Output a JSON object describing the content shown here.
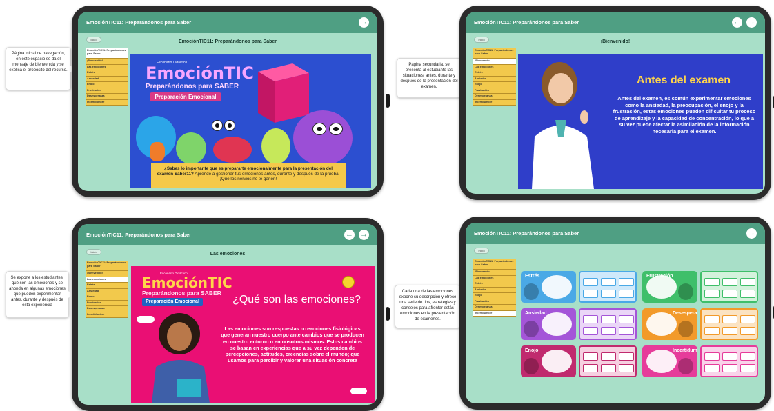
{
  "app": {
    "title": "EmociónTIC11: Preparándonos para Saber",
    "inicio_label": "Inicio",
    "menu": [
      "EmociónTIC11: Preparándonos para Saber",
      "¡Bienvenido!",
      "Las emociones",
      "Estrés",
      "Ansiedad",
      "Enojo",
      "Frustración",
      "Desesperanza",
      "Incertidumbre"
    ]
  },
  "panels": [
    {
      "page_title": "EmociónTIC11: Preparándonos para Saber",
      "callout": "Página inicial de navegación, en este espacio se da el mensaje de bienvenida y se explica el propósito del recurso.",
      "active_item": 0,
      "hero": {
        "kicker": "Escenario Didáctico",
        "brand": "EmociónTIC",
        "subtitle": "Preparándonos para SABER",
        "pill": "Preparación Emocional",
        "question": "¿Sabes lo importante que es prepararte emocionalmente para la presentación del examen Saber11?",
        "body": "Aprende a gestionar tus emociones antes, durante y después de la prueba. ¡Que los nervios no te ganen!"
      }
    },
    {
      "page_title": "¡Bienvenido!",
      "callout": "Página secundaria, se presenta al estudiante las situaciones, antes, durante y después de la presentación del examen.",
      "active_item": 1,
      "hero": {
        "title": "Antes del examen",
        "body": "Antes del examen, es común experimentar emociones como la ansiedad, la preocupación, el enojo y la frustración, estas emociones pueden dificultar tu proceso de aprendizaje y la capacidad de concentración, lo que a su vez puede afectar la asimilación de la información necesaria para el examen."
      }
    },
    {
      "page_title": "Las emociones",
      "callout": "Se expone a los estudiantes, qué son las emociones y se ahonda en algunas emociones que pueden experimentar antes, durante y después de esta experiencia",
      "active_item": 2,
      "hero": {
        "kicker": "Escenario Didáctico",
        "brand": "EmociónTIC",
        "subtitle": "Preparándonos para SABER",
        "pill": "Preparación Emocional",
        "question": "¿Qué son las emociones?",
        "body": "Las emociones son respuestas o reacciones fisiológicas que generan nuestro cuerpo ante cambios que se producen en nuestro entorno o en nosotros mismos. Estos cambios se basan en experiencias que a su vez dependen de percepciones, actitudes, creencias sobre el mundo; que usamos para percibir y valorar una situación concreta"
      }
    },
    {
      "page_title": "",
      "callout": "Cada una de las emociones expone su descripción y ofrece una serie de tips, estrategias y consejos para afrontar estás emociones en la presentación de exámenes.",
      "active_item": 8,
      "cards": [
        {
          "label": "Estrés",
          "bg": "#4aa9e6",
          "panel": "#cfe9fb"
        },
        {
          "label": "Frustración",
          "bg": "#3fbf6a",
          "panel": "#d4f2dc"
        },
        {
          "label": "Ansiedad",
          "bg": "#a455d8",
          "panel": "#ead6f7"
        },
        {
          "label": "Desesperanza",
          "bg": "#f29a2a",
          "panel": "#fbe3c2"
        },
        {
          "label": "Enojo",
          "bg": "#c02a6e",
          "panel": "#f6d0e1"
        },
        {
          "label": "Incertidumbre",
          "bg": "#e63c9a",
          "panel": "#f9d4ea"
        }
      ]
    }
  ],
  "colors": {
    "appbar": "#4f9f83",
    "screen": "#a8dfc8",
    "menu": "#f2c94c",
    "hero_blue": "#2c4fd0",
    "hero_pink": "#ea0f74",
    "title_yellow": "#ffd54a"
  },
  "icons": [
    "arrow-left-circle-icon",
    "arrow-right-circle-icon",
    "smiley-icon",
    "cloud-icon"
  ]
}
